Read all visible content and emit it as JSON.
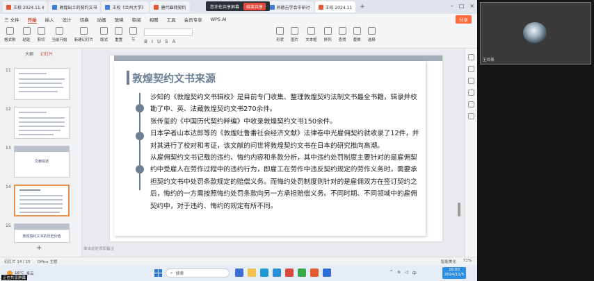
{
  "tabs": [
    {
      "label": "王校 2024.11.4",
      "color": "#e45a36"
    },
    {
      "label": "敦煌出土的契约文书",
      "color": "#3f7fd8"
    },
    {
      "label": "王校《兰州大学》",
      "color": "#3f7fd8"
    },
    {
      "label": "唐代雇佣契约",
      "color": "#e45a36"
    },
    {
      "label": "同德吉学会中研讨",
      "color": "#3f7fd8"
    },
    {
      "label": "王校 2024.11",
      "color": "#e45a36"
    }
  ],
  "share_banner": {
    "text": "您正在共享屏幕",
    "stop": "结束共享"
  },
  "menu": {
    "file": "三 文件",
    "items": [
      "开始",
      "插入",
      "设计",
      "切换",
      "动画",
      "放映",
      "审阅",
      "视图",
      "工具",
      "会员专享"
    ],
    "ai": "WPS AI",
    "share": "分享"
  },
  "ribbon": {
    "groups": [
      "格式刷",
      "粘贴",
      "剪切",
      "当前开始",
      "新建幻灯片",
      "版式",
      "重置",
      "节"
    ],
    "right_groups": [
      "形状",
      "图片",
      "文本框",
      "排列",
      "查找",
      "替换",
      "选择"
    ]
  },
  "left_panel": {
    "tabs": [
      "大纲",
      "幻灯片"
    ],
    "slides": [
      {
        "num": "11",
        "label": ""
      },
      {
        "num": "12",
        "label": ""
      },
      {
        "num": "13",
        "label": "文献综述"
      },
      {
        "num": "14",
        "label": ""
      },
      {
        "num": "15",
        "label": "敦煌契约文书的历史价值"
      }
    ]
  },
  "slide": {
    "title": "敦煌契约文书来源",
    "paragraphs": [
      "沙知的《敦煌契约文书辑校》是目前专门收集、整理敦煌契约法制文书最全书籍，辑录并校勘了中、英、法藏敦煌契约文书270余件。",
      "张传玺的《中国历代契约粹编》中收录敦煌契约文书150余件。",
      "日本学者山本达郎等的《敦煌吐鲁番社会经济文献》法律卷中光雇佣契约就收录了12件，并对其进行了校对和考证，该文献的问世将敦煌契约文书在日本的研究推向高潮。",
      "从雇佣契约文书记载的违约、悔约内容和条款分析，其中违约处罚制度主要针对的是雇佣契约中受雇人在劳作过程中的违约行为，即雇工在劳作中违反契约规定的劳作义务时，需要承担契约文书中处罚条款规定的赔偿义务。而悔约处罚制度则针对的是雇佣双方在签订契约之后，悔约的一方需按照悔约处罚条款向另一方承担赔偿义务。不同时期、不同领域中的雇佣契约中，对于违约、悔约的规定有所不同。"
    ]
  },
  "notes_placeholder": "单击此处添加备注",
  "status": {
    "slide_pos": "幻灯片 14 / 15",
    "theme": "Office 主题",
    "notes_btn": "智能美化",
    "zoom": "71%"
  },
  "taskbar": {
    "weather_temp": "16°C",
    "weather_text": "多云",
    "search_placeholder": "搜索",
    "time": "16:00",
    "date": "2024/11/5"
  },
  "camera": {
    "label": "王玲燕"
  },
  "bottom_label": "正在共享屏幕"
}
